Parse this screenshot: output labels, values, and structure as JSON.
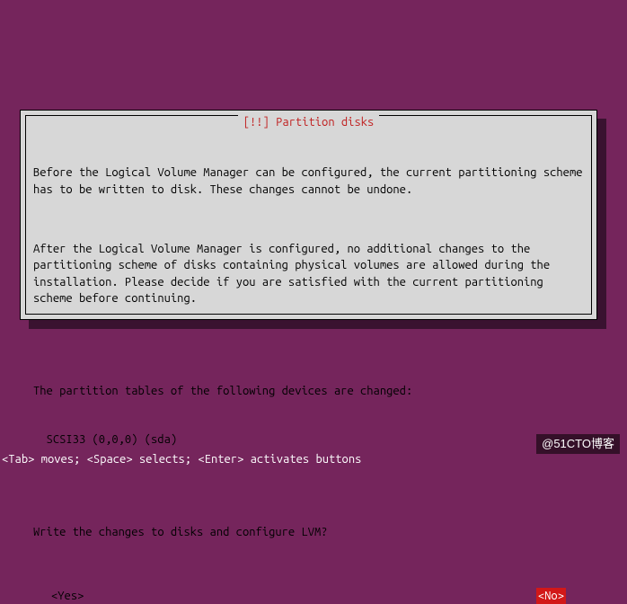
{
  "dialog": {
    "title": "[!!] Partition disks",
    "paragraph1": "Before the Logical Volume Manager can be configured, the current partitioning scheme has to be written to disk. These changes cannot be undone.",
    "paragraph2": "After the Logical Volume Manager is configured, no additional changes to the partitioning scheme of disks containing physical volumes are allowed during the installation. Please decide if you are satisfied with the current partitioning scheme before continuing.",
    "devices_heading": "The partition tables of the following devices are changed:",
    "devices": [
      "SCSI33 (0,0,0) (sda)"
    ],
    "prompt": "Write the changes to disks and configure LVM?",
    "buttons": {
      "yes": "<Yes>",
      "no": "<No>"
    },
    "selected": "no"
  },
  "helpbar": "<Tab> moves; <Space> selects; <Enter> activates buttons",
  "watermark": "@51CTO博客"
}
